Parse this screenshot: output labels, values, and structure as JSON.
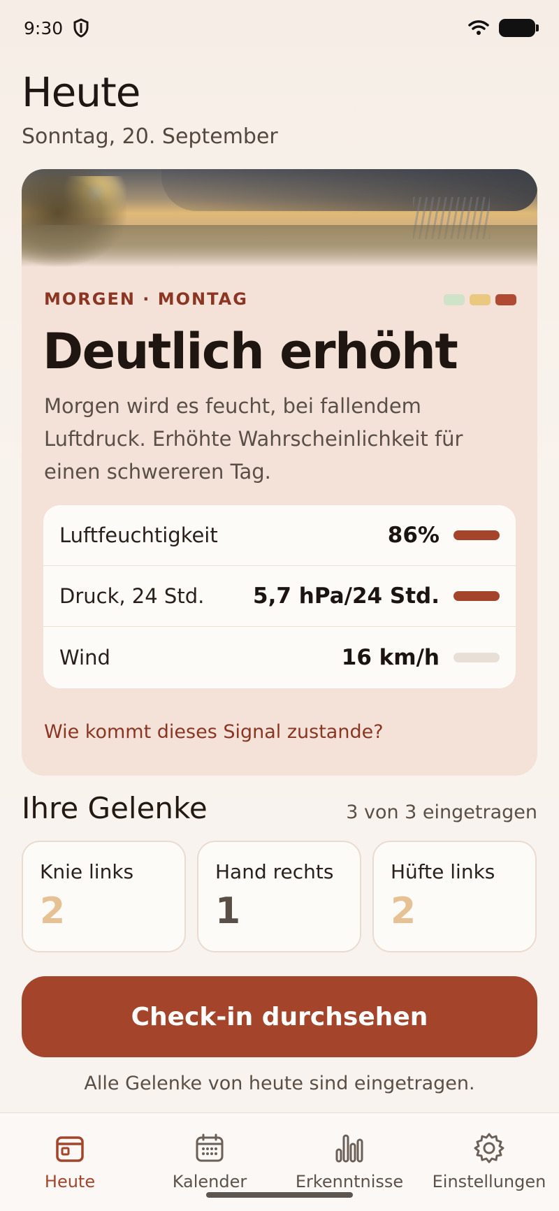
{
  "status_bar": {
    "time": "9:30",
    "icons": [
      "shield-icon",
      "wifi-icon",
      "battery-icon"
    ]
  },
  "header": {
    "title": "Heute",
    "date": "Sonntag, 20. September"
  },
  "forecast": {
    "eyebrow": "MORGEN · MONTAG",
    "level_colors": [
      "#cfe3c9",
      "#ebc87f",
      "#b04a32"
    ],
    "headline": "Deutlich erhöht",
    "description": "Morgen wird es feucht, bei fallendem Luftdruck. Erhöhte Wahrscheinlichkeit für einen schwereren Tag.",
    "metrics": [
      {
        "label": "Luftfeuchtigkeit",
        "value": "86%",
        "bar_color": "#a4452b"
      },
      {
        "label": "Druck, 24 Std.",
        "value": "5,7 hPa/24 Std.",
        "bar_color": "#a4452b"
      },
      {
        "label": "Wind",
        "value": "16 km/h",
        "bar_color": "#e8e0d6"
      }
    ],
    "signal_link": "Wie kommt dieses Signal zustande?"
  },
  "joints": {
    "title": "Ihre Gelenke",
    "meta": "3 von 3 eingetragen",
    "items": [
      {
        "name": "Knie links",
        "score": "2",
        "color": "#e6c194"
      },
      {
        "name": "Hand rechts",
        "score": "1",
        "color": "#5a4f47"
      },
      {
        "name": "Hüfte links",
        "score": "2",
        "color": "#e6c194"
      }
    ]
  },
  "cta": {
    "label": "Check-in durchsehen",
    "note": "Alle Gelenke von heute sind eingetragen."
  },
  "nav": {
    "items": [
      {
        "label": "Heute",
        "icon": "calendar-today-icon",
        "active": true
      },
      {
        "label": "Kalender",
        "icon": "calendar-grid-icon",
        "active": false
      },
      {
        "label": "Erkenntnisse",
        "icon": "bar-chart-icon",
        "active": false
      },
      {
        "label": "Einstellungen",
        "icon": "gear-icon",
        "active": false
      }
    ]
  },
  "colors": {
    "accent": "#a4452b",
    "eyebrow": "#8b3523",
    "card_background": "#f4e2d8"
  }
}
